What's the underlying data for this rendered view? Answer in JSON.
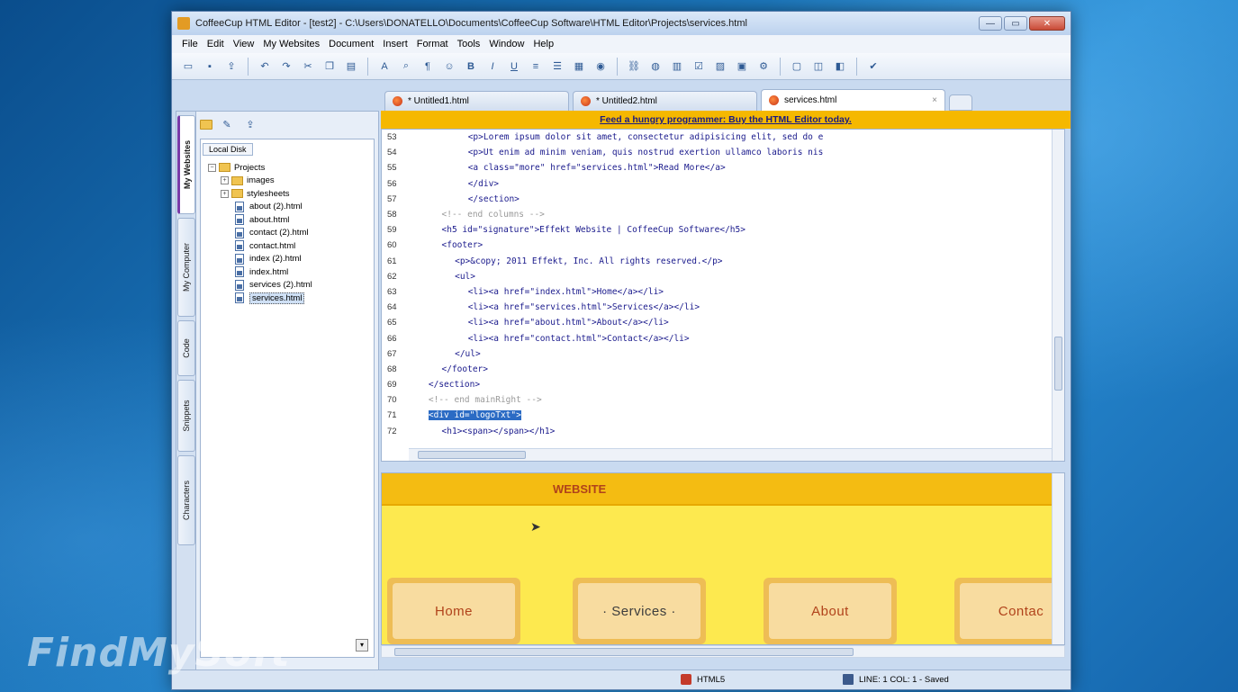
{
  "window": {
    "title": "CoffeeCup HTML Editor - [test2] - C:\\Users\\DONATELLO\\Documents\\CoffeeCup Software\\HTML Editor\\Projects\\services.html",
    "min": "—",
    "max": "▭",
    "close": "✕"
  },
  "menu": [
    "File",
    "Edit",
    "View",
    "My Websites",
    "Document",
    "Insert",
    "Format",
    "Tools",
    "Window",
    "Help"
  ],
  "tabs": [
    {
      "label": "* Untitled1.html",
      "close": "",
      "active": false
    },
    {
      "label": "* Untitled2.html",
      "close": "",
      "active": false
    },
    {
      "label": "services.html",
      "close": "×",
      "active": true
    }
  ],
  "sidebar": {
    "vertical_tabs": [
      "My Websites",
      "My Computer",
      "Code",
      "Snippets",
      "Characters"
    ],
    "panel_tab": "Local Disk",
    "tree": [
      {
        "label": "Projects",
        "type": "folder",
        "toggle": "−",
        "indent": 0
      },
      {
        "label": "images",
        "type": "folder",
        "toggle": "+",
        "indent": 1
      },
      {
        "label": "stylesheets",
        "type": "folder",
        "toggle": "+",
        "indent": 1
      },
      {
        "label": "about (2).html",
        "type": "file",
        "indent": 2
      },
      {
        "label": "about.html",
        "type": "file",
        "indent": 2
      },
      {
        "label": "contact (2).html",
        "type": "file",
        "indent": 2
      },
      {
        "label": "contact.html",
        "type": "file",
        "indent": 2
      },
      {
        "label": "index (2).html",
        "type": "file",
        "indent": 2
      },
      {
        "label": "index.html",
        "type": "file",
        "indent": 2
      },
      {
        "label": "services (2).html",
        "type": "file",
        "indent": 2
      },
      {
        "label": "services.html",
        "type": "file",
        "indent": 2,
        "selected": true
      }
    ]
  },
  "promo": "Feed a hungry programmer: Buy the HTML Editor today.",
  "code": [
    {
      "n": "53",
      "indent": 9,
      "text": "<p>Lorem ipsum dolor sit amet, consectetur adipisicing elit, sed do e",
      "kind": "tag"
    },
    {
      "n": "54",
      "indent": 9,
      "text": "<p>Ut enim ad minim veniam, quis nostrud exertion ullamco laboris nis",
      "kind": "tag"
    },
    {
      "n": "55",
      "indent": 9,
      "text": "<a class=\"more\" href=\"services.html\">Read More</a>",
      "kind": "tag"
    },
    {
      "n": "56",
      "indent": 9,
      "text": "</div>",
      "kind": "tag"
    },
    {
      "n": "57",
      "indent": 9,
      "text": "</section>",
      "kind": "tag"
    },
    {
      "n": "58",
      "indent": 5,
      "text": "<!-- end columns -->",
      "kind": "comment"
    },
    {
      "n": "59",
      "indent": 5,
      "text": "<h5 id=\"signature\">Effekt Website | CoffeeCup Software</h5>",
      "kind": "tag"
    },
    {
      "n": "60",
      "indent": 5,
      "text": "<footer>",
      "kind": "tag"
    },
    {
      "n": "61",
      "indent": 7,
      "text": "<p>&copy; 2011 Effekt, Inc. All rights reserved.</p>",
      "kind": "tag"
    },
    {
      "n": "62",
      "indent": 7,
      "text": "<ul>",
      "kind": "tag"
    },
    {
      "n": "63",
      "indent": 9,
      "text": "<li><a href=\"index.html\">Home</a></li>",
      "kind": "tag"
    },
    {
      "n": "64",
      "indent": 9,
      "text": "<li><a href=\"services.html\">Services</a></li>",
      "kind": "tag"
    },
    {
      "n": "65",
      "indent": 9,
      "text": "<li><a href=\"about.html\">About</a></li>",
      "kind": "tag"
    },
    {
      "n": "66",
      "indent": 9,
      "text": "<li><a href=\"contact.html\">Contact</a></li>",
      "kind": "tag"
    },
    {
      "n": "67",
      "indent": 7,
      "text": "</ul>",
      "kind": "tag"
    },
    {
      "n": "68",
      "indent": 5,
      "text": "</footer>",
      "kind": "tag"
    },
    {
      "n": "69",
      "indent": 3,
      "text": "</section>",
      "kind": "tag"
    },
    {
      "n": "70",
      "indent": 3,
      "text": "<!-- end mainRight -->",
      "kind": "comment"
    },
    {
      "n": "71",
      "indent": 3,
      "text": "<div id=\"logoTxt\">",
      "kind": "tag",
      "highlight": true
    },
    {
      "n": "72",
      "indent": 5,
      "text": "<h1><span></span></h1>",
      "kind": "tag"
    }
  ],
  "preview": {
    "header": "WEBSITE",
    "nav": [
      {
        "label": "Home",
        "active": false
      },
      {
        "label": "· Services ·",
        "active": true
      },
      {
        "label": "About",
        "active": false
      },
      {
        "label": "Contac",
        "active": false
      }
    ]
  },
  "status": {
    "doctype": "HTML5",
    "position": "LINE: 1  COL: 1 - Saved"
  },
  "watermark": "FindMySoft",
  "colors": {
    "promo_bar": "#f5b800",
    "preview_bg": "#fde94f",
    "preview_header": "#f4bc12",
    "nav_text": "#b1431b",
    "code_tag": "#1a1a8c",
    "code_comment": "#9a9a9a",
    "selection": "#2b6bc4"
  }
}
